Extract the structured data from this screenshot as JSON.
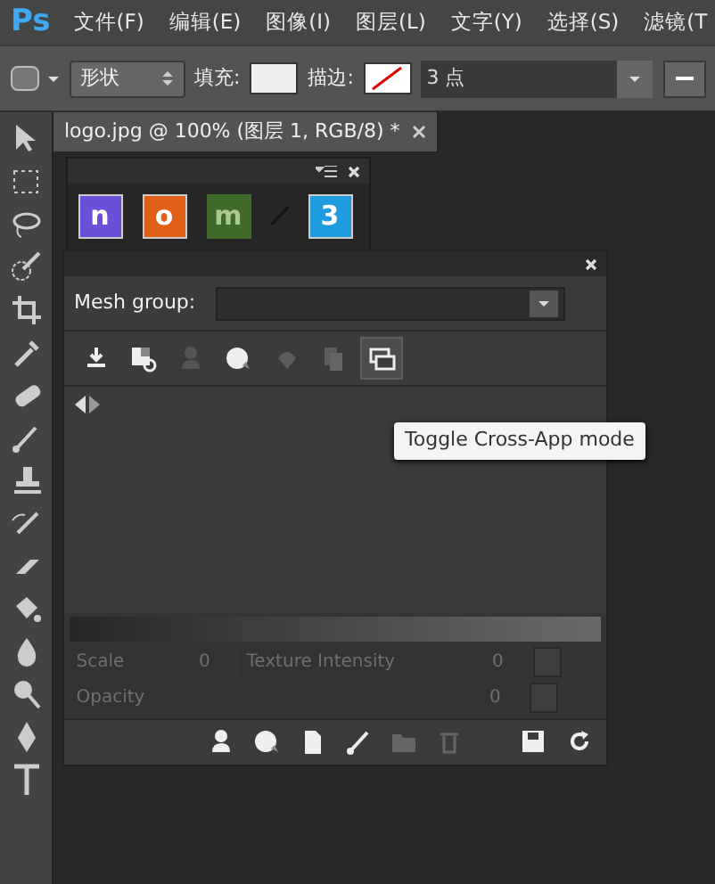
{
  "app_logo": "Ps",
  "menu": [
    "文件(F)",
    "编辑(E)",
    "图像(I)",
    "图层(L)",
    "文字(Y)",
    "选择(S)",
    "滤镜(T"
  ],
  "options_bar": {
    "shape_mode": "形状",
    "fill_label": "填充:",
    "stroke_label": "描边:",
    "stroke_width": "3 点"
  },
  "document_tab": {
    "title": "logo.jpg @  100% (图层 1, RGB/8) *"
  },
  "tools": [
    {
      "kind": "move"
    },
    {
      "kind": "marquee"
    },
    {
      "kind": "lasso"
    },
    {
      "kind": "quickselect"
    },
    {
      "kind": "crop"
    },
    {
      "kind": "eyedropper"
    },
    {
      "kind": "healing"
    },
    {
      "kind": "brush"
    },
    {
      "kind": "stamp"
    },
    {
      "kind": "historybrush"
    },
    {
      "kind": "eraser"
    },
    {
      "kind": "bucket"
    },
    {
      "kind": "blur"
    },
    {
      "kind": "dodge"
    },
    {
      "kind": "pen"
    },
    {
      "kind": "type"
    }
  ],
  "app_panel": {
    "apps": [
      {
        "letter": "n",
        "color": "#6b4fd8",
        "enabled": true
      },
      {
        "letter": "o",
        "color": "#e0601a",
        "enabled": true
      },
      {
        "letter": "m",
        "color": "#3f6a2a",
        "enabled": false
      },
      {
        "letter": "3",
        "color": "#1f9be0",
        "enabled": true
      }
    ]
  },
  "mesh_panel": {
    "group_label": "Mesh group:",
    "toolbar": [
      {
        "kind": "import",
        "selected": false,
        "disabled": false
      },
      {
        "kind": "texture",
        "selected": false,
        "disabled": false
      },
      {
        "kind": "figure",
        "selected": false,
        "disabled": true
      },
      {
        "kind": "sphere",
        "selected": false,
        "disabled": false
      },
      {
        "kind": "shape",
        "selected": false,
        "disabled": true
      },
      {
        "kind": "copy",
        "selected": false,
        "disabled": true
      },
      {
        "kind": "crossapp",
        "selected": true,
        "disabled": false
      }
    ],
    "tooltip": "Toggle Cross-App mode",
    "params": [
      {
        "label": "Scale",
        "value": "0",
        "disabled": true
      },
      {
        "label": "Texture Intensity",
        "value": "0",
        "disabled": true
      },
      {
        "label": "Opacity",
        "value": "0",
        "disabled": true
      }
    ],
    "footer": [
      {
        "kind": "figure",
        "disabled": false
      },
      {
        "kind": "sphere",
        "disabled": false
      },
      {
        "kind": "page",
        "disabled": false
      },
      {
        "kind": "brush",
        "disabled": false
      },
      {
        "kind": "folder",
        "disabled": true
      },
      {
        "kind": "trash",
        "disabled": true
      },
      {
        "kind": "save",
        "disabled": false
      },
      {
        "kind": "refresh",
        "disabled": false
      }
    ]
  }
}
